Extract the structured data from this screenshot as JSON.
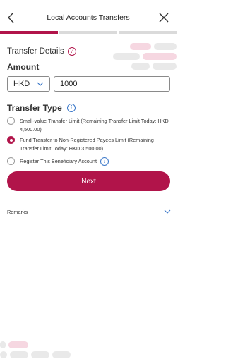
{
  "header": {
    "title": "Local Accounts Transfers",
    "back_icon": "chevron-left-icon",
    "close_icon": "close-icon"
  },
  "progress": {
    "current_step": 1,
    "total_steps": 3
  },
  "transfer_details": {
    "label": "Transfer Details",
    "help_icon_text": "?"
  },
  "amount": {
    "label": "Amount",
    "currency": "HKD",
    "value": "1000"
  },
  "transfer_type": {
    "label": "Transfer Type",
    "info_icon_text": "i",
    "options": [
      {
        "text": "Small-value Transfer Limit (Remaining Transfer Limit Today: HKD 4,500.00)",
        "checked": false
      },
      {
        "text": "Fund Transfer to Non-Registered Payees Limit (Remaining Transfer Limit Today: HKD 3,500.00)",
        "checked": true
      },
      {
        "text": "Register This Beneficiary Account",
        "checked": false
      }
    ]
  },
  "next_button": {
    "label": "Next"
  },
  "remarks": {
    "label": "Remarks"
  },
  "colors": {
    "accent": "#b1144a",
    "info": "#3b78c9",
    "deco_pink": "#f6d7e1",
    "deco_grey": "#e9e9e9"
  }
}
